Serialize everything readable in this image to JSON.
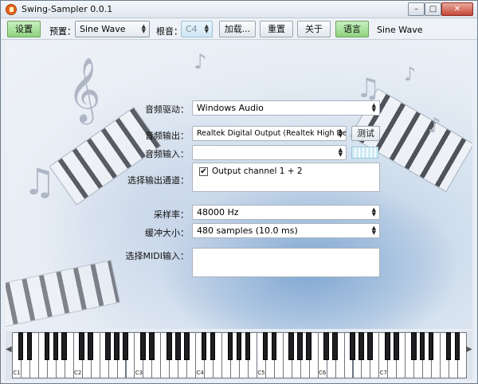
{
  "window": {
    "title": "Swing-Sampler 0.0.1",
    "controls": {
      "minimize": "–",
      "maximize": "□",
      "close": "✕"
    }
  },
  "toolbar": {
    "settings_label": "设置",
    "preset_label": "预置：",
    "preset_value": "Sine Wave",
    "root_label": "根音：",
    "root_value": "C4",
    "load_label": "加载...",
    "reset_label": "重置",
    "about_label": "关于",
    "language_label": "语言",
    "current_preset": "Sine Wave"
  },
  "form": {
    "audio_driver_label": "音频驱动：",
    "audio_driver_value": "Windows Audio",
    "audio_output_label": "音频输出：",
    "audio_output_value": "Realtek Digital Output (Realtek High Definition Audio)",
    "test_label": "测试",
    "audio_input_label": "音频输入：",
    "audio_input_value": "",
    "output_channels_label": "选择输出通道：",
    "output_channel_item": "Output channel 1 + 2",
    "output_channel_checked": true,
    "sample_rate_label": "采样率：",
    "sample_rate_value": "48000 Hz",
    "buffer_size_label": "缓冲大小：",
    "buffer_size_value": "480 samples (10.0 ms)",
    "midi_input_label": "选择MIDI输入："
  },
  "keyboard": {
    "octave_labels": [
      "C1",
      "C2",
      "C3",
      "C4",
      "C5",
      "C6",
      "C7"
    ],
    "scroll_left": "◀",
    "scroll_right": "▶"
  },
  "colors": {
    "accent_green": "#8fd37f",
    "close_red": "#c6483a",
    "background": "#e9eef4"
  }
}
